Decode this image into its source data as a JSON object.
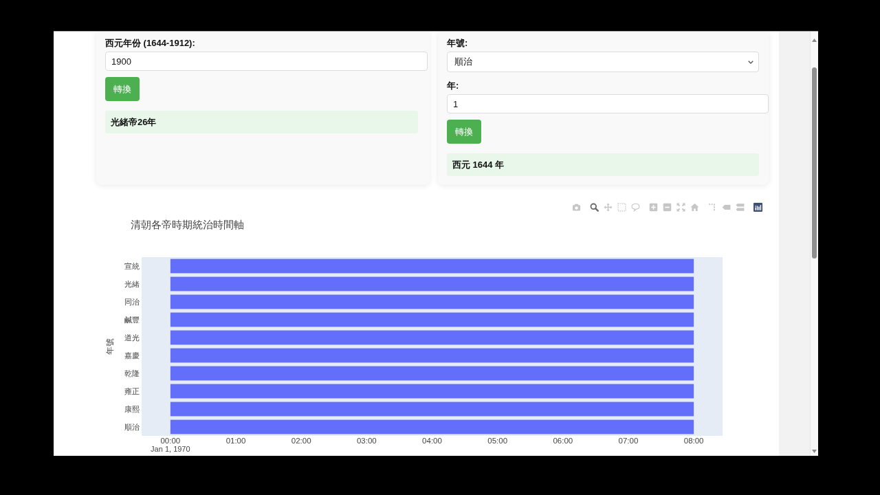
{
  "year_to_era": {
    "label": "西元年份 (1644-1912):",
    "year_input": {
      "value": "1900"
    },
    "button": "轉換",
    "result": "光緒帝26年"
  },
  "era_to_year": {
    "era_label": "年號:",
    "era_select": {
      "value": "順治"
    },
    "year_label": "年:",
    "year_input": {
      "value": "1"
    },
    "button": "轉換",
    "result": "西元 1644 年"
  },
  "chart": {
    "modebar": [
      {
        "buttons": [
          {
            "kind": "camera",
            "selected": false
          }
        ]
      },
      {
        "buttons": [
          {
            "kind": "zoom",
            "selected": true
          },
          {
            "kind": "pan",
            "selected": false
          },
          {
            "kind": "select",
            "selected": false
          },
          {
            "kind": "lasso",
            "selected": false
          }
        ]
      },
      {
        "buttons": [
          {
            "kind": "zoom_in",
            "selected": false
          },
          {
            "kind": "zoom_out",
            "selected": false
          },
          {
            "kind": "autoscale",
            "selected": false
          },
          {
            "kind": "reset",
            "selected": false
          }
        ]
      },
      {
        "buttons": [
          {
            "kind": "spikes",
            "selected": false
          },
          {
            "kind": "closest",
            "selected": false
          },
          {
            "kind": "compare",
            "selected": false
          }
        ]
      }
    ],
    "chart_data": {
      "type": "bar",
      "orientation": "horizontal",
      "title": "清朝各帝時期統治時間軸",
      "ylabel": "年號",
      "categories": [
        "宣統",
        "光緒",
        "同治",
        "鹹豐",
        "道光",
        "嘉慶",
        "乾隆",
        "雍正",
        "康熙",
        "順治"
      ],
      "series": [
        {
          "color": "#636efa",
          "values": [
            8,
            8,
            8,
            8,
            8,
            8,
            8,
            8,
            8,
            8
          ]
        }
      ],
      "xlim": [
        -0.44,
        8.44
      ],
      "xticks": [
        {
          "value": 0,
          "label": "00:00"
        },
        {
          "value": 1,
          "label": "01:00"
        },
        {
          "value": 2,
          "label": "02:00"
        },
        {
          "value": 3,
          "label": "03:00"
        },
        {
          "value": 4,
          "label": "04:00"
        },
        {
          "value": 5,
          "label": "05:00"
        },
        {
          "value": 6,
          "label": "06:00"
        },
        {
          "value": 7,
          "label": "07:00"
        },
        {
          "value": 8,
          "label": "08:00"
        }
      ],
      "annotations": [
        "Jan 1, 1970"
      ]
    }
  }
}
